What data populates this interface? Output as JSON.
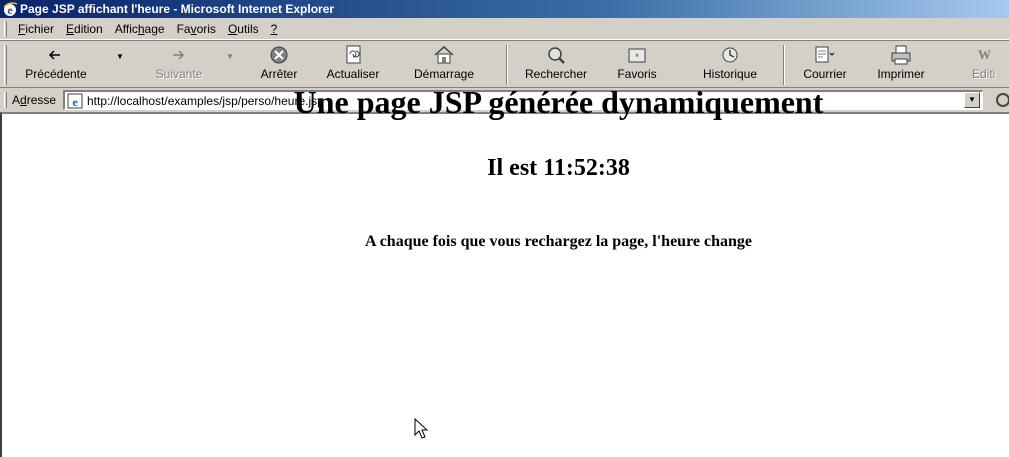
{
  "window": {
    "title": "Page JSP affichant l'heure - Microsoft Internet Explorer"
  },
  "menu": {
    "items": [
      {
        "pre": "",
        "key": "F",
        "post": "ichier"
      },
      {
        "pre": "",
        "key": "E",
        "post": "dition"
      },
      {
        "pre": "Affic",
        "key": "h",
        "post": "age"
      },
      {
        "pre": "Fa",
        "key": "v",
        "post": "oris"
      },
      {
        "pre": "",
        "key": "O",
        "post": "utils"
      },
      {
        "pre": "",
        "key": "?",
        "post": ""
      }
    ]
  },
  "toolbar": {
    "back_label": "Précédente",
    "forward_label": "Suivante",
    "stop_label": "Arrêter",
    "refresh_label": "Actualiser",
    "home_label": "Démarrage",
    "search_label": "Rechercher",
    "favorites_label": "Favoris",
    "history_label": "Historique",
    "mail_label": "Courrier",
    "print_label": "Imprimer",
    "edit_label": "Editi"
  },
  "address": {
    "label_pre": "A",
    "label_key": "d",
    "label_post": "resse",
    "url": "http://localhost/examples/jsp/perso/heure.jsp"
  },
  "page": {
    "heading": "Une page JSP générée dynamiquement",
    "time_line": "Il est 11:52:38",
    "note": "A chaque fois que vous rechargez la page, l'heure change"
  },
  "icons": {
    "app": "ie-logo-icon",
    "cursor": "mouse-pointer-icon"
  }
}
